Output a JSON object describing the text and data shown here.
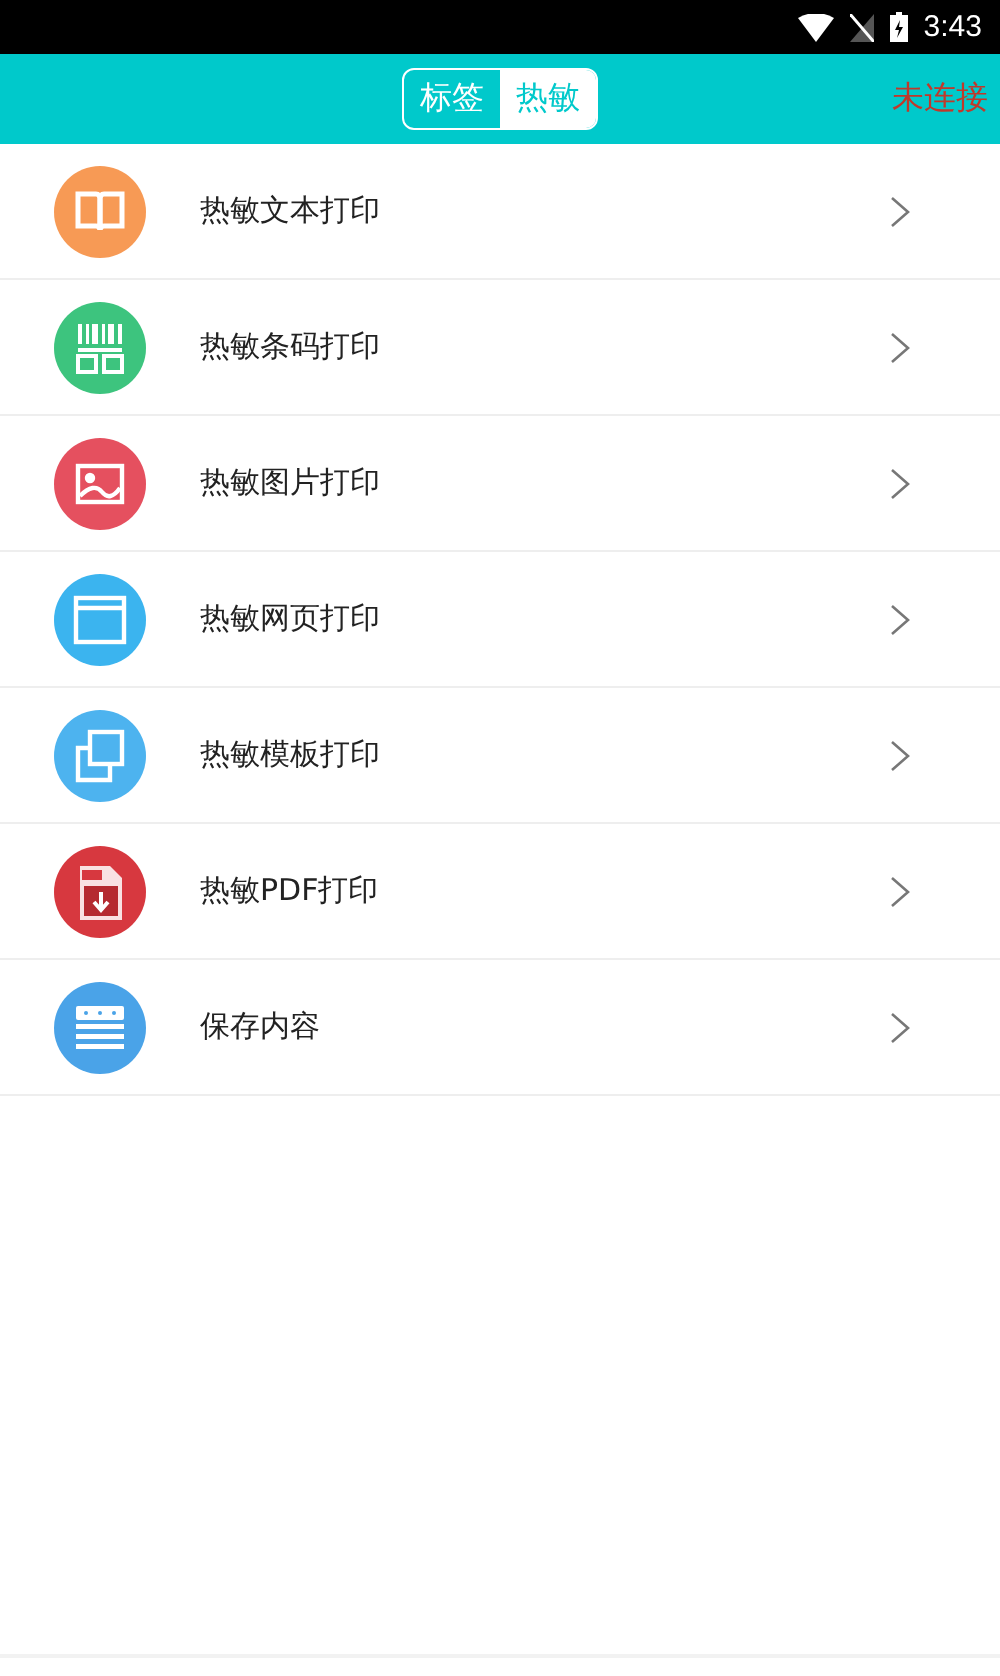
{
  "status_bar": {
    "time": "3:43"
  },
  "header": {
    "tabs": [
      {
        "label": "标签",
        "selected": false
      },
      {
        "label": "热敏",
        "selected": true
      }
    ],
    "connection": "未连接"
  },
  "items": [
    {
      "label": "热敏文本打印",
      "kind": "book",
      "color": "#f79a55"
    },
    {
      "label": "热敏条码打印",
      "kind": "barcode",
      "color": "#3dc47e"
    },
    {
      "label": "热敏图片打印",
      "kind": "image",
      "color": "#e5505f"
    },
    {
      "label": "热敏网页打印",
      "kind": "web",
      "color": "#3bb4ef"
    },
    {
      "label": "热敏模板打印",
      "kind": "copy",
      "color": "#4db3ef"
    },
    {
      "label": "热敏PDF打印",
      "kind": "pdf",
      "color": "#d7383f"
    },
    {
      "label": "保存内容",
      "kind": "list",
      "color": "#4aa3e8"
    }
  ]
}
